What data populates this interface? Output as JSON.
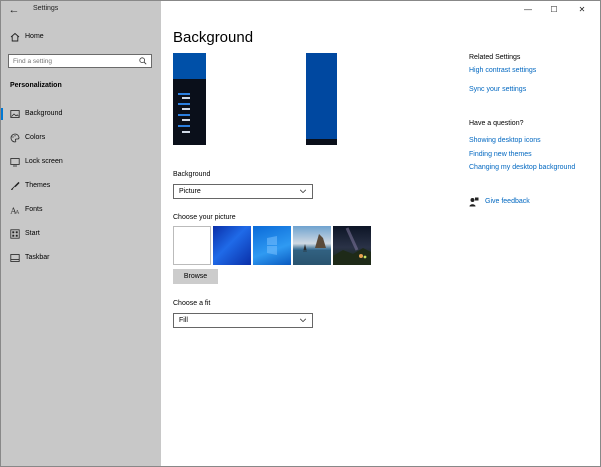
{
  "window": {
    "title": "Settings",
    "controls": {
      "minimize": "—",
      "maximize": "☐",
      "close": "✕"
    }
  },
  "sidebar": {
    "home_label": "Home",
    "search": {
      "placeholder": "Find a setting",
      "value": ""
    },
    "section_title": "Personalization",
    "items": [
      {
        "label": "Background",
        "icon": "picture-icon",
        "selected": true
      },
      {
        "label": "Colors",
        "icon": "palette-icon",
        "selected": false
      },
      {
        "label": "Lock screen",
        "icon": "lock-screen-icon",
        "selected": false
      },
      {
        "label": "Themes",
        "icon": "themes-icon",
        "selected": false
      },
      {
        "label": "Fonts",
        "icon": "fonts-icon",
        "selected": false
      },
      {
        "label": "Start",
        "icon": "start-icon",
        "selected": false
      },
      {
        "label": "Taskbar",
        "icon": "taskbar-icon",
        "selected": false
      }
    ]
  },
  "main": {
    "title": "Background",
    "background_label": "Background",
    "background_value": "Picture",
    "choose_picture_label": "Choose your picture",
    "browse_label": "Browse",
    "fit_label": "Choose a fit",
    "fit_value": "Fill"
  },
  "right": {
    "related_title": "Related Settings",
    "related_links": [
      "High contrast settings",
      "Sync your settings"
    ],
    "question_title": "Have a question?",
    "question_links": [
      "Showing desktop icons",
      "Finding new themes",
      "Changing my desktop background"
    ],
    "feedback_label": "Give feedback"
  },
  "colors": {
    "accent": "#0078d4",
    "link": "#0067c0",
    "sidebar_bg": "#c8c8c8"
  }
}
